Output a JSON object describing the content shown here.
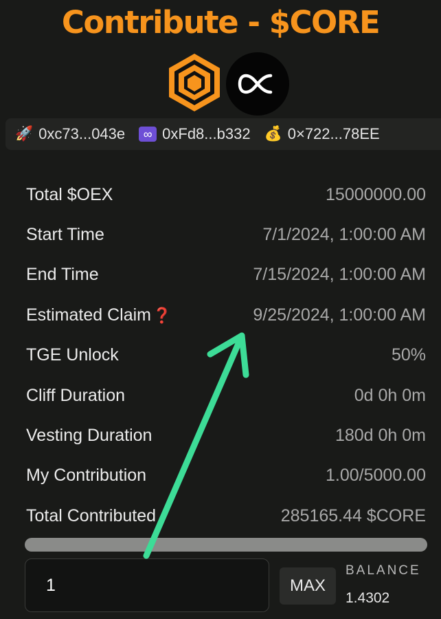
{
  "header": {
    "title": "Contribute - $CORE"
  },
  "addresses": [
    {
      "icon": "rocket-icon",
      "emoji": "🚀",
      "text": "0xc73...043e"
    },
    {
      "icon": "infinity-icon",
      "emoji": "∞",
      "text": "0xFd8...b332"
    },
    {
      "icon": "money-bag-icon",
      "emoji": "💰",
      "text": "0×722...78EE"
    }
  ],
  "details": {
    "total_oex": {
      "label": "Total $OEX",
      "value": "15000000.00"
    },
    "start_time": {
      "label": "Start Time",
      "value": "7/1/2024, 1:00:00 AM"
    },
    "end_time": {
      "label": "End Time",
      "value": "7/15/2024, 1:00:00 AM"
    },
    "estimated_claim": {
      "label": "Estimated Claim",
      "icon": "❓",
      "value": "9/25/2024, 1:00:00 AM"
    },
    "tge_unlock": {
      "label": "TGE Unlock",
      "value": "50%"
    },
    "cliff_duration": {
      "label": "Cliff Duration",
      "value": "0d 0h 0m"
    },
    "vesting_duration": {
      "label": "Vesting Duration",
      "value": "180d 0h 0m"
    },
    "my_contribution": {
      "label": "My Contribution",
      "value": "1.00/5000.00"
    },
    "total_contributed": {
      "label": "Total Contributed",
      "value": "285165.44 $CORE"
    }
  },
  "progress": {
    "fraction": 0
  },
  "form": {
    "amount_value": "1",
    "max_label": "MAX",
    "balance_label": "BALANCE",
    "balance_value": "1.4302"
  },
  "colors": {
    "accent": "#f7941d",
    "background": "#191a18",
    "annotation_arrow": "#3ddc97"
  }
}
